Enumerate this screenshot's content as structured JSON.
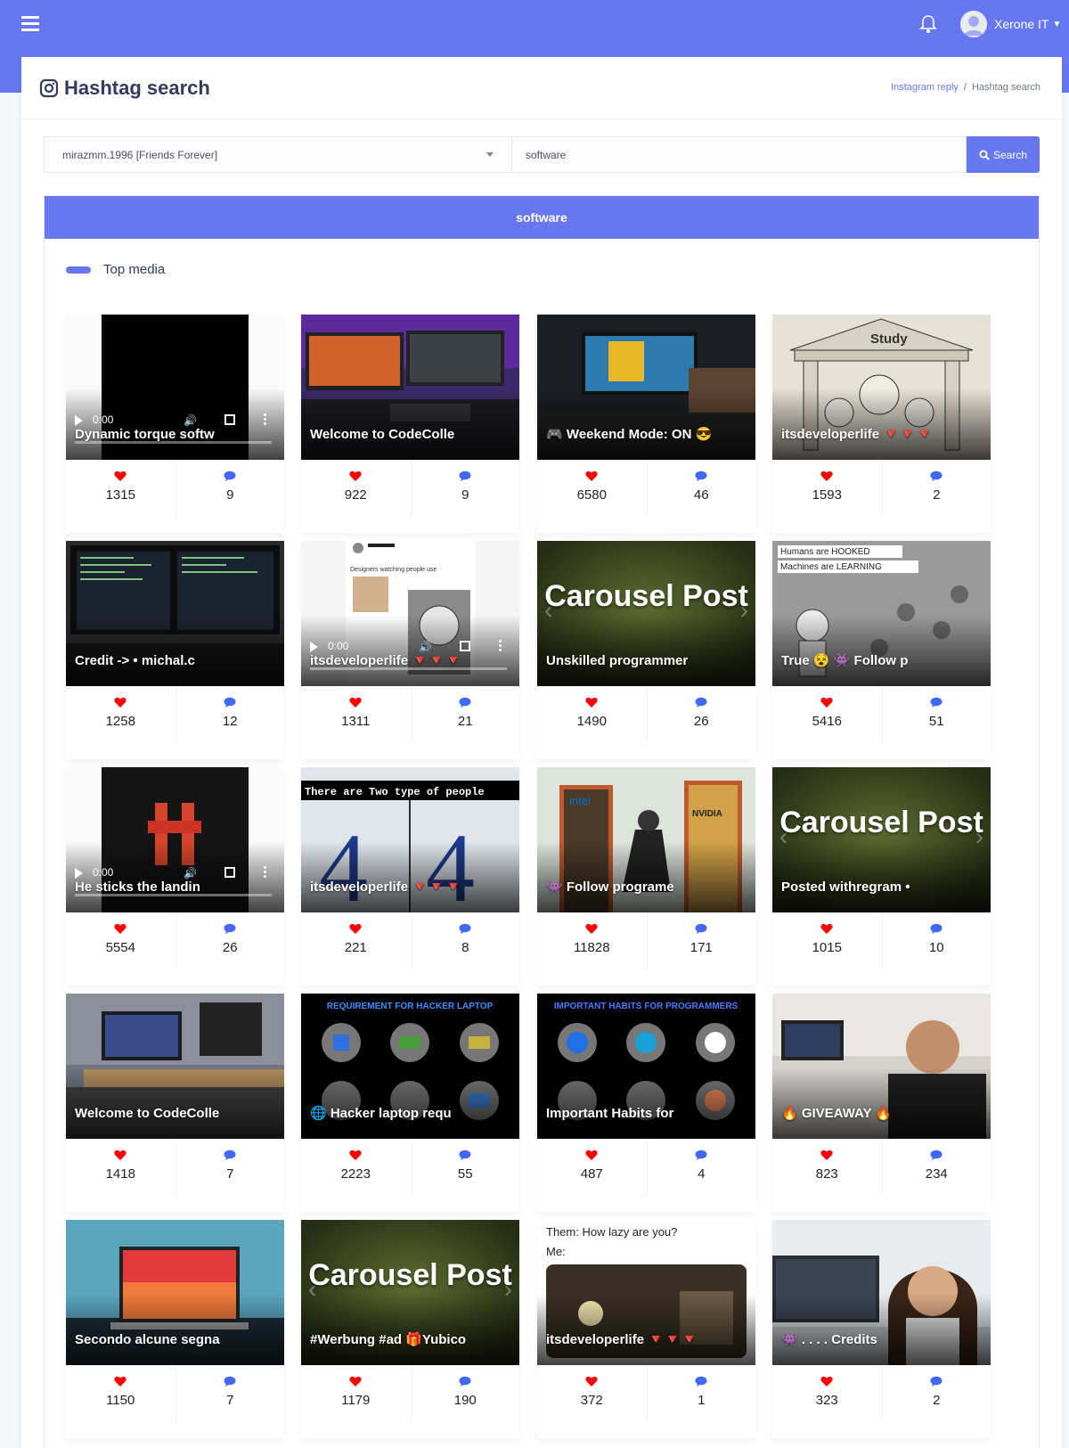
{
  "user": {
    "name": "Xerone IT"
  },
  "page": {
    "title": "Hashtag search"
  },
  "breadcrumb": {
    "parent": "Instagram reply",
    "separator": "/",
    "current": "Hashtag search"
  },
  "search": {
    "account": "mirazmm.1996 [Friends Forever]",
    "query": "software",
    "button": "Search"
  },
  "result": {
    "header": "software",
    "section_title": "Top media"
  },
  "colors": {
    "primary": "#6777ef",
    "like": "#fc0303",
    "comment": "#4267f4"
  },
  "posts": [
    {
      "caption": "Dynamic torque softw",
      "likes": "1315",
      "comments": "9",
      "video": true,
      "time": "0:00",
      "bg": "video-black"
    },
    {
      "caption": "Welcome to CodeColle",
      "likes": "922",
      "comments": "9",
      "bg": "desk-neon"
    },
    {
      "caption": "🎮 Weekend Mode: ON 😎",
      "likes": "6580",
      "comments": "46",
      "bg": "gaming"
    },
    {
      "caption": "itsdeveloperlife 🔻🔻🔻",
      "likes": "1593",
      "comments": "2",
      "bg": "cartoon-study"
    },
    {
      "caption": "Credit -> • michal.c",
      "likes": "1258",
      "comments": "12",
      "bg": "monitor-code"
    },
    {
      "caption": "itsdeveloperlife 🔻🔻🔻",
      "likes": "1311",
      "comments": "21",
      "video": true,
      "time": "0:00",
      "bg": "tweet-video"
    },
    {
      "caption": "Unskilled programmer",
      "likes": "1490",
      "comments": "26",
      "carousel": "Carousel\nPost",
      "bg": "carousel"
    },
    {
      "caption": "True 😵 👾 Follow p",
      "likes": "5416",
      "comments": "51",
      "bg": "robot-sketch"
    },
    {
      "caption": "He sticks the landin",
      "likes": "5554",
      "comments": "26",
      "video": true,
      "time": "0:00",
      "bg": "robot-video"
    },
    {
      "caption": "itsdeveloperlife 🔻🔻🔻",
      "likes": "221",
      "comments": "8",
      "bg": "two-types"
    },
    {
      "caption": "👾 Follow programe",
      "likes": "11828",
      "comments": "171",
      "bg": "intel-nvidia"
    },
    {
      "caption": "Posted withregram •",
      "likes": "1015",
      "comments": "10",
      "carousel": "Carousel\nPost",
      "bg": "carousel"
    },
    {
      "caption": "Welcome to CodeColle",
      "likes": "1418",
      "comments": "7",
      "bg": "desk-room"
    },
    {
      "caption": "🌐 Hacker laptop requ",
      "likes": "2223",
      "comments": "55",
      "bg": "hacker-req"
    },
    {
      "caption": "Important Habits for",
      "likes": "487",
      "comments": "4",
      "bg": "habits"
    },
    {
      "caption": "🔥 GIVEAWAY 🔥",
      "likes": "823",
      "comments": "234",
      "bg": "giveaway"
    },
    {
      "caption": "Secondo alcune segna",
      "likes": "1150",
      "comments": "7",
      "bg": "laptop-blue"
    },
    {
      "caption": "#Werbung #ad 🎁Yubico",
      "likes": "1179",
      "comments": "190",
      "carousel": "Carousel\nPost",
      "bg": "carousel"
    },
    {
      "caption": "itsdeveloperlife 🔻🔻🔻",
      "likes": "372",
      "comments": "1",
      "bg": "lazy-meme"
    },
    {
      "caption": "👾 . . . . Credits",
      "likes": "323",
      "comments": "2",
      "bg": "woman-desk"
    }
  ],
  "thumb_text": {
    "study": "Study",
    "tweet": "Designers watching people use their interfaces #designtwitter",
    "hooked": "Humans are HOOKED",
    "learning": "Machines are LEARNING",
    "two_types": "There are Two type of people",
    "hacker_title": "REQUIREMENT FOR HACKER LAPTOP",
    "habits_title": "IMPORTANT HABITS FOR PROGRAMMERS",
    "lazy_q": "Them: How lazy are you?",
    "lazy_me": "Me:"
  }
}
